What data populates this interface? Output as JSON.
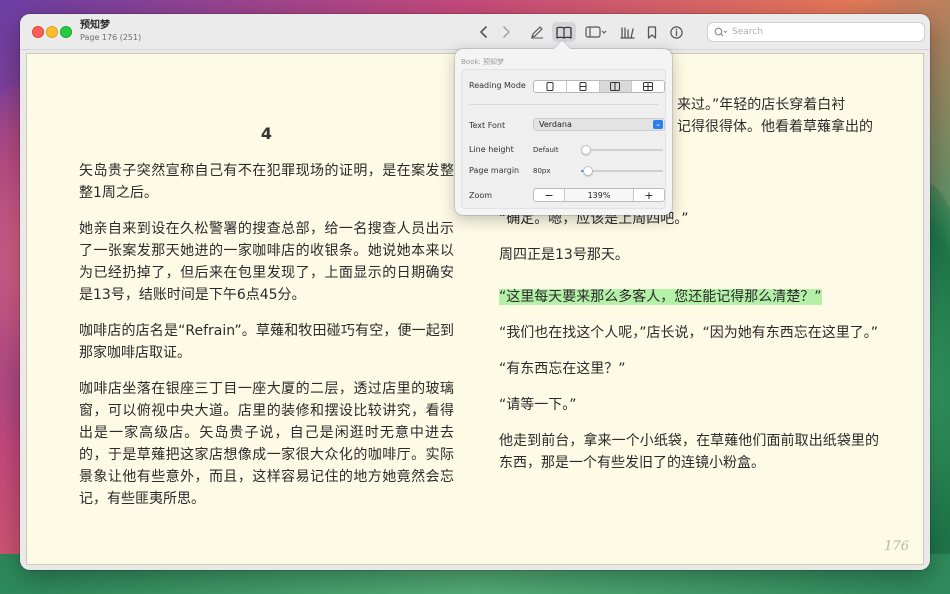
{
  "window": {
    "title": "预知梦",
    "subtitle": "Page 176 (251)"
  },
  "toolbar": {
    "back_icon": "chevron-left-icon",
    "forward_icon": "chevron-right-icon",
    "annotate_icon": "pencil-icon",
    "reading_icon": "book-open-icon",
    "sidebar_icon": "sidebar-icon",
    "library_icon": "library-icon",
    "bookmark_icon": "bookmark-icon",
    "info_icon": "info-icon"
  },
  "search": {
    "placeholder": "Search"
  },
  "book": {
    "chapter": "4",
    "left_paragraphs": [
      "矢岛贵子突然宣称自己有不在犯罪现场的证明，是在案发整整1周之后。",
      "她亲自来到设在久松警署的搜查总部，给一名搜查人员出示了一张案发那天她进的一家咖啡店的收银条。她说她本来以为已经扔掉了，但后来在包里发现了，上面显示的日期确安是13号，结账时间是下午6点45分。",
      "咖啡店的店名是“Refrain”。草薙和牧田碰巧有空，便一起到那家咖啡店取证。",
      "咖啡店坐落在银座三丁目一座大厦的二层，透过店里的玻璃窗，可以俯视中央大道。店里的装修和摆设比较讲究，看得出是一家高级店。矢岛贵子说，自己是闲逛时无意中进去的，于是草薙把这家店想像成一家很大众化的咖啡厅。实际景象让他有些意外，而且，这样容易记住的地方她竟然会忘记，有些匪夷所思。"
    ],
    "right_partial_1": "来过。”年轻的店长穿着白衬",
    "right_partial_2": "记得很得体。他看着草薙拿出的",
    "right_partial_3": "“确定。嗯，应该是上周四吧。”",
    "right_paragraphs": [
      "周四正是13号那天。",
      "“这里每天要来那么多客人，您还能记得那么清楚？”",
      "“我们也在找这个人呢，”店长说，“因为她有东西忘在这里了。”",
      "“有东西忘在这里？”",
      "“请等一下。”",
      "他走到前台，拿来一个小纸袋，在草薙他们面前取出纸袋里的东西，那是一个有些发旧了的连镜小粉盒。"
    ],
    "page_number": "176"
  },
  "popover": {
    "header": "Book: 预知梦",
    "reading_mode_label": "Reading Mode",
    "reading_modes": [
      "single-page",
      "scroll",
      "two-page",
      "grid"
    ],
    "reading_mode_selected": 2,
    "text_font_label": "Text Font",
    "text_font_value": "Verdana",
    "line_height_label": "Line height",
    "line_height_value": "Default",
    "line_height_level": 0.0,
    "page_margin_label": "Page margin",
    "page_margin_value": "80px",
    "page_margin_level": 0.03,
    "zoom_label": "Zoom",
    "zoom_minus": "−",
    "zoom_value": "139%",
    "zoom_plus": "+",
    "accent_color": "#3a85f0"
  }
}
